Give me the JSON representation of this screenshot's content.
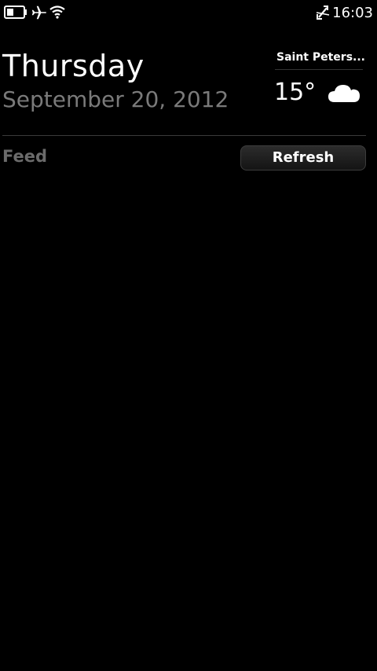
{
  "status_bar": {
    "time": "16:03",
    "icons": [
      "battery-icon",
      "airplane-mode-icon",
      "wifi-icon",
      "no-sim-icon"
    ]
  },
  "header": {
    "day": "Thursday",
    "date": "September 20, 2012"
  },
  "weather": {
    "location": "Saint Peters...",
    "temperature": "15°",
    "condition_icon": "cloud-icon"
  },
  "feed": {
    "label": "Feed",
    "refresh_label": "Refresh"
  },
  "colors": {
    "background": "#000000",
    "primary_text": "#ffffff",
    "secondary_text": "#7a7a7a",
    "feed_label": "#6b6b6b"
  }
}
